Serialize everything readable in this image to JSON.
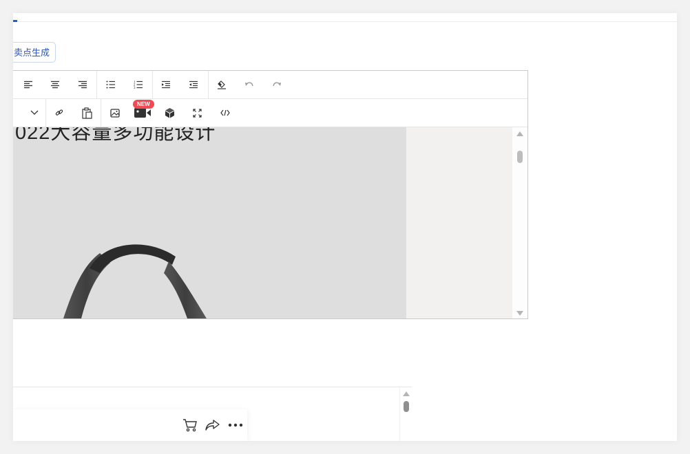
{
  "ai_button": {
    "label": "卖点生成"
  },
  "editor": {
    "toolbar_row1": [
      "align-left-icon",
      "align-center-icon",
      "align-right-icon",
      "bullet-list-icon",
      "numbered-list-icon",
      "indent-icon",
      "outdent-icon",
      "eraser-icon",
      "undo-icon",
      "redo-icon"
    ],
    "toolbar_row2": [
      "dropdown-chevron-icon",
      "link-icon",
      "paste-icon",
      "image-icon",
      "video-icon",
      "3d-model-icon",
      "fullscreen-icon",
      "source-code-icon"
    ],
    "new_badge": "NEW",
    "heading_fragment": "022大容量多功能设计"
  },
  "preview": {
    "icons": [
      "cart-icon",
      "share-icon",
      "more-icon"
    ]
  },
  "colors": {
    "accent": "#1f5fd0",
    "ai_button_text": "#2e55b3",
    "badge": "#ee4b52",
    "image_bg": "#dedede"
  }
}
